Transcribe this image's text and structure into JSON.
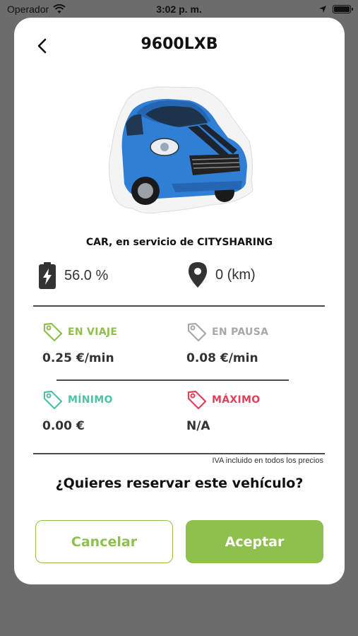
{
  "status_bar": {
    "carrier": "Operador",
    "time": "3:02 p. m."
  },
  "header": {
    "title": "9600LXB"
  },
  "vehicle": {
    "service_text": "CAR, en servicio de CITYSHARING",
    "battery": "56.0 %",
    "distance": "0 (km)"
  },
  "prices": {
    "trip": {
      "label": "EN VIAJE",
      "value": "0.25 €/min",
      "color": "#8fbf4d"
    },
    "pause": {
      "label": "EN PAUSA",
      "value": "0.08 €/min",
      "color": "#a8a8a8"
    },
    "min": {
      "label": "MÍNIMO",
      "value": "0.00 €",
      "color": "#4fc2a3"
    },
    "max": {
      "label": "MÁXIMO",
      "value": "N/A",
      "color": "#e0415a"
    }
  },
  "iva_note": "IVA incluido en todos los precios",
  "question": "¿Quieres reservar este vehículo?",
  "buttons": {
    "cancel": "Cancelar",
    "accept": "Aceptar"
  },
  "colors": {
    "accent": "#8fbf4d",
    "backdrop": "#6c6c6c",
    "car_body": "#2f7fd6"
  }
}
